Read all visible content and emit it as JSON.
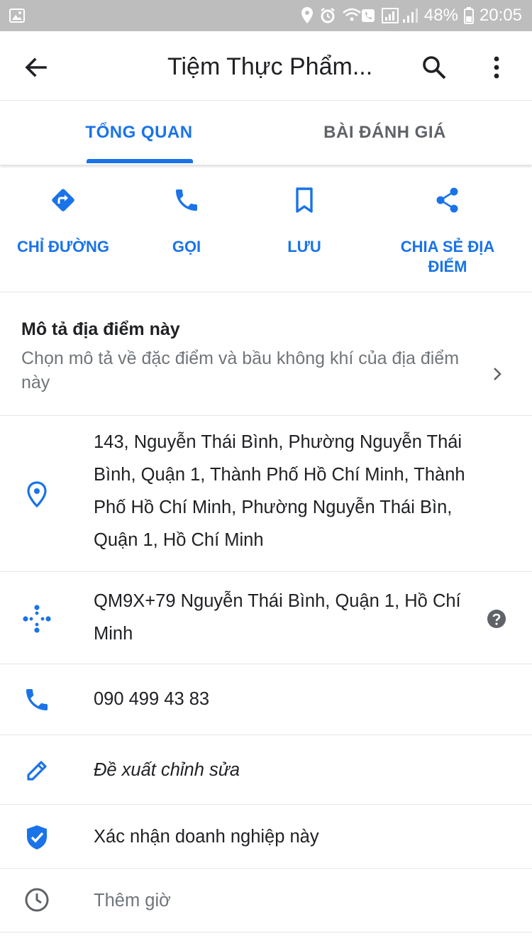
{
  "status_bar": {
    "battery": "48%",
    "time": "20:05",
    "icons": [
      "image-icon",
      "location-icon",
      "alarm-icon",
      "wifi-call-icon",
      "signal-icon",
      "battery-icon"
    ]
  },
  "app_bar": {
    "title": "Tiệm Thực Phẩm...",
    "back_icon": "arrow-back-icon",
    "search_icon": "search-icon",
    "more_icon": "more-vert-icon"
  },
  "tabs": [
    {
      "label": "TỔNG QUAN",
      "selected": true
    },
    {
      "label": "BÀI ĐÁNH GIÁ",
      "selected": false
    }
  ],
  "actions": [
    {
      "label": "CHỈ ĐƯỜNG",
      "icon": "directions-icon"
    },
    {
      "label": "GỌI",
      "icon": "phone-icon"
    },
    {
      "label": "LƯU",
      "icon": "bookmark-icon"
    },
    {
      "label": "CHIA SẺ ĐỊA ĐIỂM",
      "icon": "share-icon"
    }
  ],
  "describe": {
    "heading": "Mô tả địa điểm này",
    "subtext": "Chọn mô tả về đặc điểm và bầu không khí của địa điểm này"
  },
  "rows": {
    "address": "143, Nguyễn Thái Bình, Phường Nguyễn Thái Bình, Quận 1, Thành Phố Hồ Chí Minh, Thành Phố Hồ Chí Minh, Phường Nguyễn Thái Bìn, Quận 1, Hồ Chí Minh",
    "plus_code": "QM9X+79 Nguyễn Thái Bình, Quận 1, Hồ Chí Minh",
    "phone": "090 499 43 83",
    "suggest_edit": "Đề xuất chỉnh sửa",
    "claim_business": "Xác nhận doanh nghiệp này",
    "add_hours": "Thêm giờ"
  },
  "colors": {
    "accent": "#1a73e8",
    "status_bar_bg": "#bdbdbd",
    "secondary_text": "#70757a",
    "divider": "#e6e6e6"
  }
}
